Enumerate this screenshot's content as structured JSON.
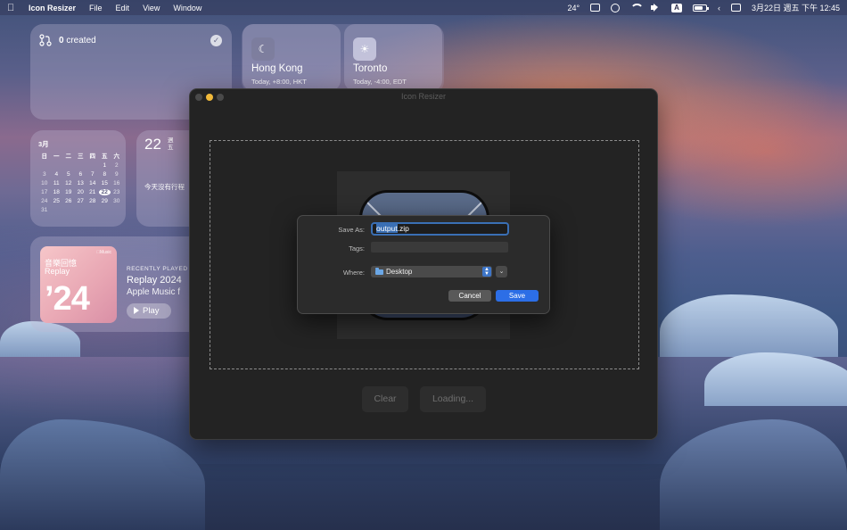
{
  "menubar": {
    "app_name": "Icon Resizer",
    "menus": [
      "File",
      "Edit",
      "View",
      "Window"
    ],
    "temperature": "24°",
    "input_source": "A",
    "datetime": "3月22日 週五 下午 12:45"
  },
  "widgets": {
    "created": {
      "count": "0",
      "label": "created"
    },
    "clocks": [
      {
        "city": "Hong Kong",
        "detail": "Today, +8:00, HKT",
        "icon": "moon-icon"
      },
      {
        "city": "Toronto",
        "detail": "Today, -4:00, EDT",
        "icon": "sun-icon"
      }
    ],
    "calendar": {
      "month": "3月",
      "weekdays": [
        "日",
        "一",
        "二",
        "三",
        "四",
        "五",
        "六"
      ],
      "days": [
        "",
        "",
        "",
        "",
        "",
        "1",
        "2",
        "3",
        "4",
        "5",
        "6",
        "7",
        "8",
        "9",
        "10",
        "11",
        "12",
        "13",
        "14",
        "15",
        "16",
        "17",
        "18",
        "19",
        "20",
        "21",
        "22",
        "23",
        "24",
        "25",
        "26",
        "27",
        "28",
        "29",
        "30",
        "31",
        "",
        "",
        "",
        "",
        "",
        ""
      ],
      "today": "22"
    },
    "day": {
      "number": "22",
      "weekday": "週五",
      "no_events": "今天沒有行程"
    },
    "music": {
      "art_brand": "Music",
      "art_line1": "音樂回憶",
      "art_line2": "Replay",
      "art_big": "’24",
      "recently_played": "RECENTLY PLAYED",
      "title": "Replay 2024",
      "artist": "Apple Music f",
      "play_label": "Play"
    }
  },
  "window": {
    "title": "Icon Resizer",
    "clear_label": "Clear",
    "loading_label": "Loading..."
  },
  "dialog": {
    "save_as_label": "Save As:",
    "filename_selected": "output",
    "filename_ext": ".zip",
    "tags_label": "Tags:",
    "where_label": "Where:",
    "where_value": "Desktop",
    "cancel_label": "Cancel",
    "save_label": "Save"
  }
}
